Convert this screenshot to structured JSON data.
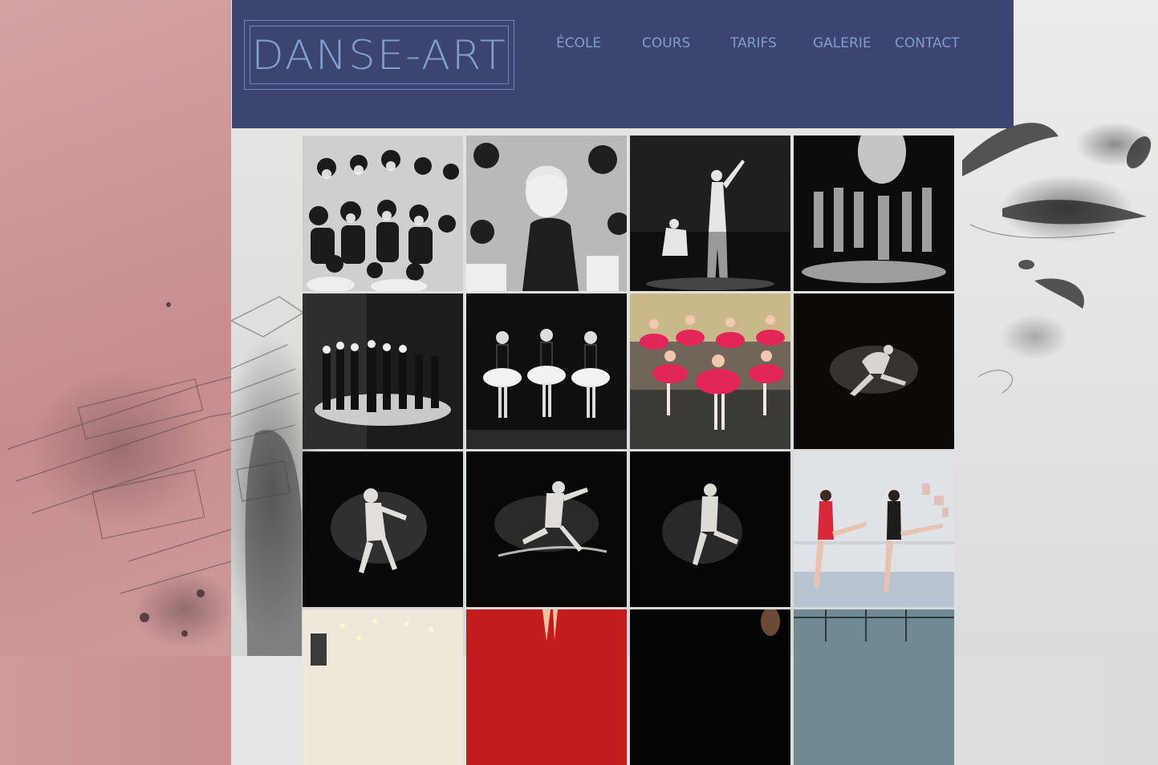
{
  "site": {
    "logo_text": "DANSE-ART"
  },
  "nav": [
    {
      "label": "ÉCOLE"
    },
    {
      "label": "COURS"
    },
    {
      "label": "TARIFS"
    },
    {
      "label": "GALERIE"
    },
    {
      "label": "CONTACT"
    }
  ],
  "colors": {
    "header_bg": "#3c4570",
    "nav_text": "#7f9ccc",
    "logo_text": "#7fa0cf",
    "left_panel": "#c98f92"
  },
  "gallery": {
    "thumbnails": [
      {
        "name": "photo-children-group",
        "tone": "bw"
      },
      {
        "name": "photo-girl-portrait",
        "tone": "bw"
      },
      {
        "name": "photo-stage-duo",
        "tone": "bw"
      },
      {
        "name": "photo-stage-troupe",
        "tone": "bw"
      },
      {
        "name": "photo-spotlight-line",
        "tone": "bw"
      },
      {
        "name": "photo-three-tutus",
        "tone": "bw"
      },
      {
        "name": "photo-pink-tutus-class",
        "tone": "color"
      },
      {
        "name": "photo-powder-leap",
        "tone": "bw"
      },
      {
        "name": "photo-powder-dancer-1",
        "tone": "bw"
      },
      {
        "name": "photo-powder-dancer-2",
        "tone": "bw"
      },
      {
        "name": "photo-powder-dancer-3",
        "tone": "bw"
      },
      {
        "name": "photo-barre-class",
        "tone": "color"
      },
      {
        "name": "photo-studio-lights",
        "tone": "color"
      },
      {
        "name": "photo-red-backdrop",
        "tone": "color"
      },
      {
        "name": "photo-dark-portrait",
        "tone": "color"
      },
      {
        "name": "photo-glass-roof-studio",
        "tone": "color"
      }
    ]
  }
}
